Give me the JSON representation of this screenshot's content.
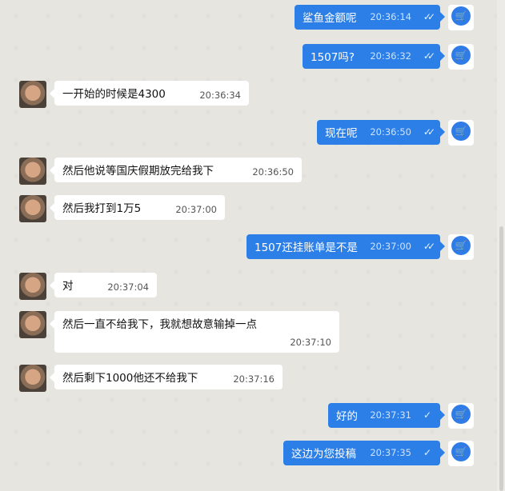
{
  "messages": [
    {
      "side": "out",
      "text": "鲨鱼金额呢",
      "time": "20:36:14",
      "ticks": "double"
    },
    {
      "side": "out",
      "text": "1507吗?",
      "time": "20:36:32",
      "ticks": "double"
    },
    {
      "side": "in",
      "text": "一开始的时候是4300",
      "time": "20:36:34"
    },
    {
      "side": "out",
      "text": "现在呢",
      "time": "20:36:50",
      "ticks": "double"
    },
    {
      "side": "in",
      "text": "然后他说等国庆假期放完给我下",
      "time": "20:36:50"
    },
    {
      "side": "in",
      "text": "然后我打到1万5",
      "time": "20:37:00"
    },
    {
      "side": "out",
      "text": "1507还挂账单是不是",
      "time": "20:37:00",
      "ticks": "double"
    },
    {
      "side": "in",
      "text": "对",
      "time": "20:37:04"
    },
    {
      "side": "in",
      "text": "然后一直不给我下，我就想故意输掉一点",
      "time": "20:37:10"
    },
    {
      "side": "in",
      "text": "然后剩下1000他还不给我下",
      "time": "20:37:16"
    },
    {
      "side": "out",
      "text": "好的",
      "time": "20:37:31",
      "ticks": "single"
    },
    {
      "side": "out",
      "text": "这边为您投稿",
      "time": "20:37:35",
      "ticks": "single"
    }
  ],
  "icons": {
    "double_tick": "✓✓",
    "single_tick": "✓",
    "cart": "🛒"
  },
  "colors": {
    "outgoing_bubble": "#2b7fe6",
    "incoming_bubble": "#ffffff",
    "background": "#e7e5e0"
  }
}
